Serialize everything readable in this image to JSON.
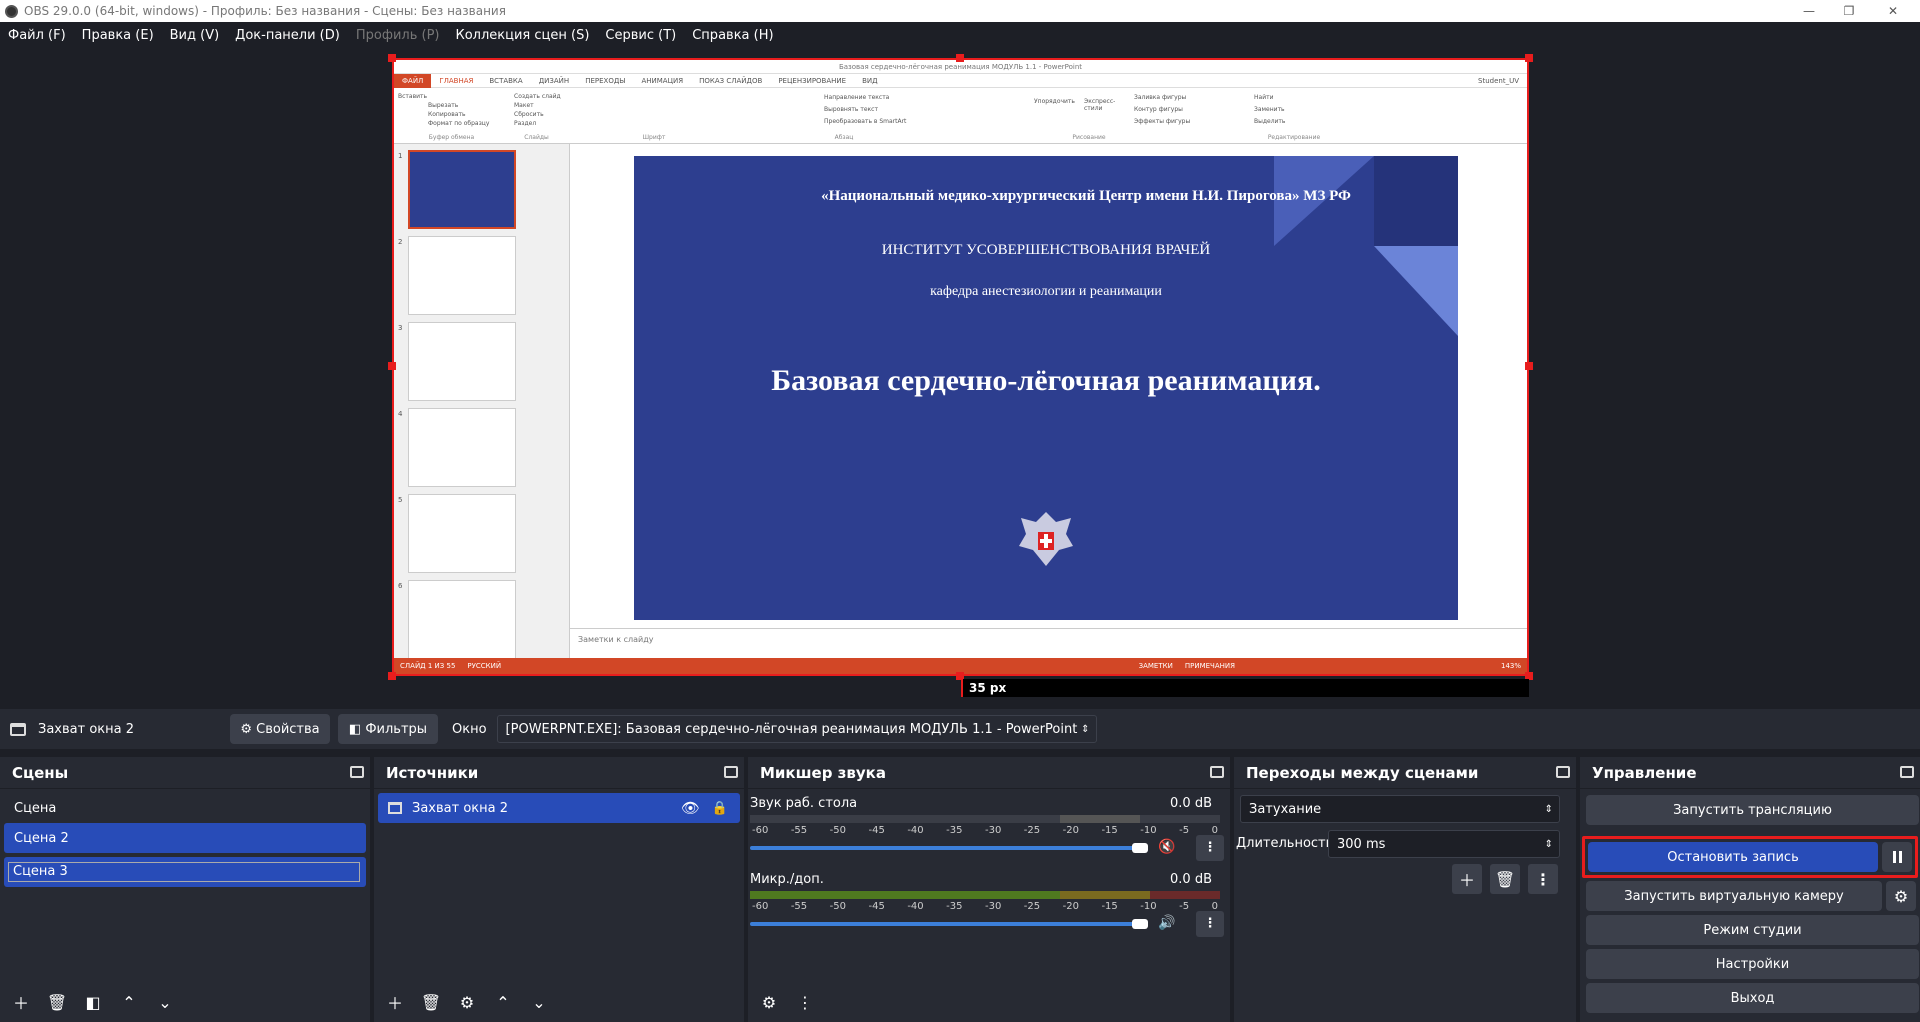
{
  "window": {
    "title": "OBS 29.0.0 (64-bit, windows) - Профиль: Без названия - Сцены: Без названия",
    "minimize": "—",
    "maximize": "❐",
    "close": "✕"
  },
  "menu": [
    "Файл (F)",
    "Правка (E)",
    "Вид (V)",
    "Док-панели (D)",
    "Профиль (P)",
    "Коллекция сцен (S)",
    "Сервис (T)",
    "Справка (H)"
  ],
  "preview": {
    "offset_label": "35 px",
    "app_title": "Базовая сердечно-лёгочная реанимация МОДУЛЬ 1.1 - PowerPoint",
    "user": "Student_UV",
    "tabs": [
      "ФАЙЛ",
      "ГЛАВНАЯ",
      "ВСТАВКА",
      "ДИЗАЙН",
      "ПЕРЕХОДЫ",
      "АНИМАЦИЯ",
      "ПОКАЗ СЛАЙДОВ",
      "РЕЦЕНЗИРОВАНИЕ",
      "ВИД"
    ],
    "ribbon_groups": [
      "Буфер обмена",
      "Слайды",
      "Шрифт",
      "Абзац",
      "Рисование",
      "Редактирование"
    ],
    "ribbon_items": [
      "Вставить",
      "Вырезать",
      "Копировать",
      "Формат по образцу",
      "Создать слайд",
      "Макет",
      "Сбросить",
      "Раздел",
      "Направление текста",
      "Выровнять текст",
      "Преобразовать в SmartArt",
      "Упорядочить",
      "Экспресс-стили",
      "Заливка фигуры",
      "Контур фигуры",
      "Эффекты фигуры",
      "Найти",
      "Заменить",
      "Выделить"
    ],
    "thumb_numbers": [
      "1",
      "2",
      "3",
      "4",
      "5",
      "6"
    ],
    "slide": {
      "line1": "«Национальный медико-хирургический Центр имени Н.И. Пирогова» МЗ РФ",
      "line2": "ИНСТИТУТ УСОВЕРШЕНСТВОВАНИЯ ВРАЧЕЙ",
      "line3": "кафедра анестезиологии и реанимации",
      "title": "Базовая сердечно-лёгочная реанимация."
    },
    "notes_placeholder": "Заметки к слайду",
    "status_left": "СЛАЙД 1 ИЗ 55",
    "status_lang": "РУССКИЙ",
    "status_notes": "ЗАМЕТКИ",
    "status_comments": "ПРИМЕЧАНИЯ",
    "status_zoom": "143%",
    "colors": {
      "accent": "#d24726",
      "slide_bg": "#2d3e8f"
    }
  },
  "sourcebar": {
    "source_name": "Захват окна 2",
    "properties": "Свойства",
    "filters": "Фильтры",
    "window_label": "Окно",
    "window_value": "[POWERPNT.EXE]: Базовая сердечно-лёгочная реанимация МОДУЛЬ 1.1 - PowerPoint"
  },
  "scenes": {
    "title": "Сцены",
    "items": [
      {
        "label": "Сцена"
      },
      {
        "label": "Сцена 2"
      },
      {
        "label": "Сцена 3"
      }
    ]
  },
  "sources": {
    "title": "Источники",
    "items": [
      {
        "label": "Захват окна 2"
      }
    ]
  },
  "mixer": {
    "title": "Микшер звука",
    "tracks": [
      {
        "name": "Звук раб. стола",
        "db": "0.0 dB",
        "muted": true,
        "volume": 1.0
      },
      {
        "name": "Микр./доп.",
        "db": "0.0 dB",
        "muted": false,
        "volume": 1.0
      }
    ],
    "scale": [
      "-60",
      "-55",
      "-50",
      "-45",
      "-40",
      "-35",
      "-30",
      "-25",
      "-20",
      "-15",
      "-10",
      "-5",
      "0"
    ]
  },
  "transitions": {
    "title": "Переходы между сценами",
    "type": "Затухание",
    "duration_label": "Длительность",
    "duration_value": "300 ms"
  },
  "controls": {
    "title": "Управление",
    "start_stream": "Запустить трансляцию",
    "stop_record": "Остановить запись",
    "start_virtualcam": "Запустить виртуальную камеру",
    "studio_mode": "Режим студии",
    "settings": "Настройки",
    "exit": "Выход",
    "colors": {
      "active": "#284cb8",
      "highlight": "#e81d1d"
    }
  }
}
